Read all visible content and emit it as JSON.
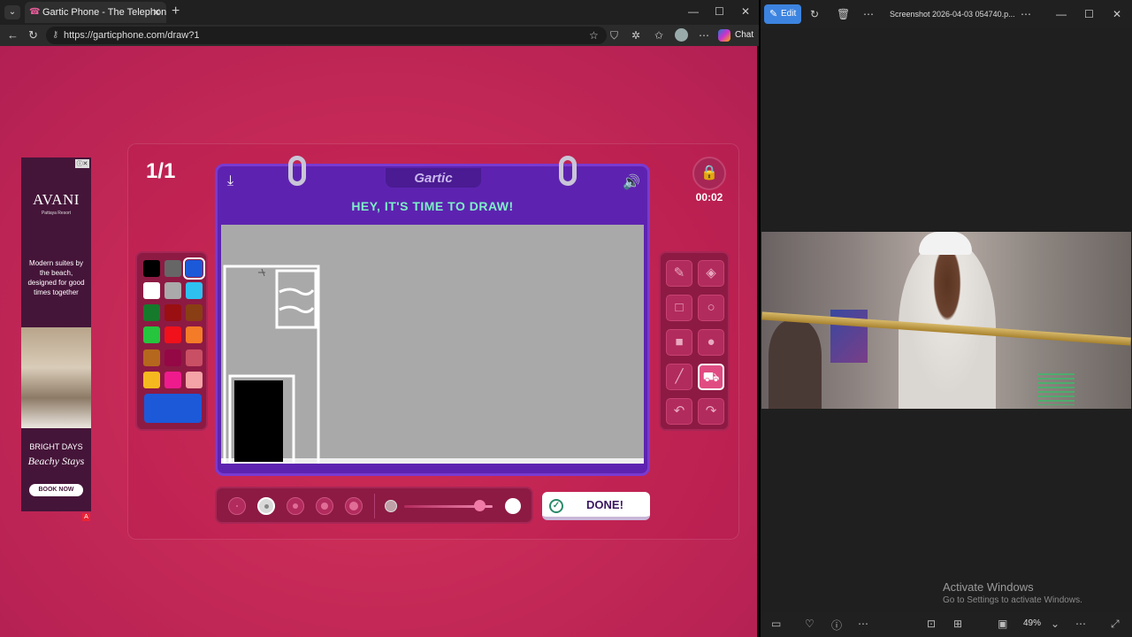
{
  "browser": {
    "tab_title": "Gartic Phone - The Telephone Gar",
    "url": "https://garticphone.com/draw?1",
    "chat_label": "Chat"
  },
  "ad": {
    "brand": "AVANI",
    "subbrand": "Pattaya Resort",
    "copy": "Modern suites by the beach, designed for good times together",
    "bright": "BRIGHT DAYS",
    "script": "Beachy Stays",
    "cta": "BOOK NOW"
  },
  "game": {
    "round": "1/1",
    "logo": "Gartic",
    "title": "HEY, IT'S TIME TO DRAW!",
    "timer": "00:02",
    "done_label": "DONE!",
    "colors": {
      "black": "#000000",
      "dark_gray": "#666666",
      "blue": "#1c59d8",
      "white": "#ffffff",
      "light_gray": "#aaaaaa",
      "sky_blue": "#2ec1f0",
      "dark_green": "#157a2b",
      "dark_red": "#9a0f12",
      "brown": "#8a3e14",
      "green": "#25c53d",
      "red": "#f0111b",
      "orange": "#f47b27",
      "tan": "#b5681d",
      "maroon": "#950846",
      "rose": "#c94f64",
      "yellow": "#f5b91f",
      "pink": "#ef1b8d",
      "light_pink": "#f4a3a6",
      "selected": "#1c59d8"
    },
    "opacity_level": 0.85
  },
  "viewer": {
    "edit_label": "Edit",
    "filename": "Screenshot 2026-04-03 054740.p...",
    "activate_title": "Activate Windows",
    "activate_sub": "Go to Settings to activate Windows.",
    "zoom": "49%"
  }
}
